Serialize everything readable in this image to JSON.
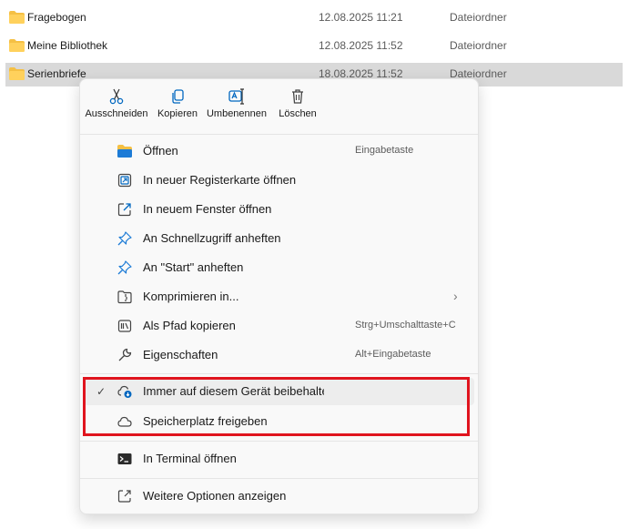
{
  "files": [
    {
      "name": "Fragebogen",
      "date": "12.08.2025 11:21",
      "type": "Dateiordner"
    },
    {
      "name": "Meine Bibliothek",
      "date": "12.08.2025 11:52",
      "type": "Dateiordner"
    },
    {
      "name": "Serienbriefe",
      "date": "18.08.2025 11:52",
      "type": "Dateiordner"
    }
  ],
  "quick_actions": [
    {
      "label": "Ausschneiden",
      "icon": "cut-icon"
    },
    {
      "label": "Kopieren",
      "icon": "copy-icon"
    },
    {
      "label": "Umbenennen",
      "icon": "rename-icon"
    },
    {
      "label": "Löschen",
      "icon": "delete-icon"
    }
  ],
  "menu": {
    "open": {
      "label": "Öffnen",
      "shortcut": "Eingabetaste"
    },
    "open_tab": {
      "label": "In neuer Registerkarte öffnen"
    },
    "open_window": {
      "label": "In neuem Fenster öffnen"
    },
    "pin_quick": {
      "label": "An Schnellzugriff anheften"
    },
    "pin_start": {
      "label": "An \"Start\" anheften"
    },
    "compress": {
      "label": "Komprimieren in..."
    },
    "copy_path": {
      "label": "Als Pfad kopieren",
      "shortcut": "Strg+Umschalttaste+C"
    },
    "properties": {
      "label": "Eigenschaften",
      "shortcut": "Alt+Eingabetaste"
    },
    "keep_device": {
      "label": "Immer auf diesem Gerät beibehalten",
      "checked": "✓"
    },
    "free_space": {
      "label": "Speicherplatz freigeben"
    },
    "terminal": {
      "label": "In Terminal öffnen"
    },
    "more_options": {
      "label": "Weitere Optionen anzeigen"
    }
  },
  "colors": {
    "folder": "#f5c044",
    "accent": "#0067c0",
    "highlight_border": "#e0141e",
    "selected_row": "#d9d9d9"
  }
}
